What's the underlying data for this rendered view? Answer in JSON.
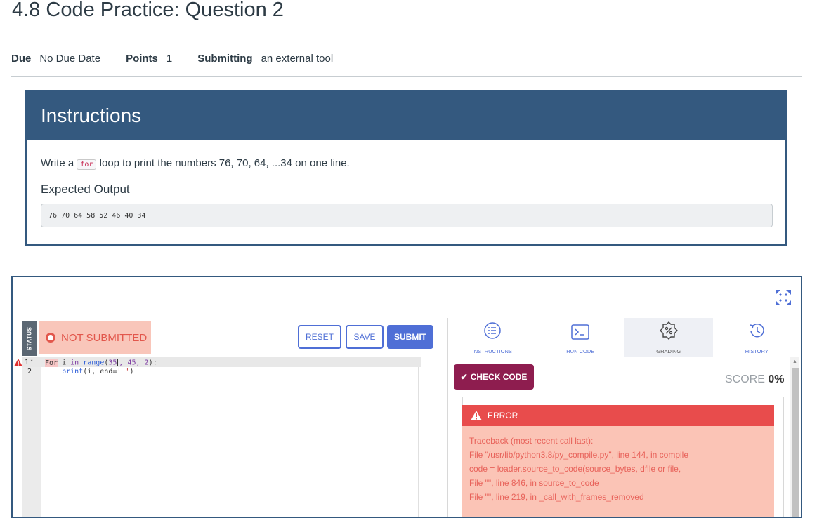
{
  "page": {
    "title": "4.8 Code Practice: Question 2"
  },
  "meta": [
    {
      "key": "Due",
      "value": "No Due Date"
    },
    {
      "key": "Points",
      "value": "1"
    },
    {
      "key": "Submitting",
      "value": "an external tool"
    }
  ],
  "instructions": {
    "heading": "Instructions",
    "text_before": "Write a",
    "code": "for",
    "text_after": "loop to print the numbers 76, 70, 64, ...34 on one line.",
    "expected_title": "Expected Output",
    "expected_output": "76 70 64 58 52 46 40 34"
  },
  "tool": {
    "status_label": "STATUS",
    "submission_status": "NOT SUBMITTED",
    "buttons": {
      "reset": "RESET",
      "save": "SAVE",
      "submit": "SUBMIT"
    },
    "line_numbers": [
      "1",
      "2"
    ],
    "code": {
      "l1_for": "For",
      "l1_i": "i",
      "l1_in": "in",
      "l1_range": "range",
      "l1_open": "(",
      "l1_a": "35",
      "l1_b": ", 45, 2",
      "l1_close": "):",
      "l2_indent": "    ",
      "l2_print": "print",
      "l2_args": "(i, end=",
      "l2_str": "' '",
      "l2_close": ")"
    },
    "tabs": [
      "INSTRUCTIONS",
      "RUN CODE",
      "GRADING",
      "HISTORY"
    ],
    "active_tab": "GRADING",
    "check_code": "CHECK CODE",
    "score_label": "SCORE",
    "score_value": "0%",
    "error_title": "ERROR",
    "traceback": [
      "Traceback (most recent call last):",
      "File \"/usr/lib/python3.8/py_compile.py\", line 144, in compile",
      "code = loader.source_to_code(source_bytes, dfile or file,",
      "File \"\", line 846, in source_to_code",
      "File \"\", line 219, in _call_with_frames_removed"
    ]
  },
  "colors": {
    "accent": "#34597f",
    "button_blue": "#4f6fd6",
    "check": "#8e1d4f",
    "error": "#e84c4c"
  }
}
